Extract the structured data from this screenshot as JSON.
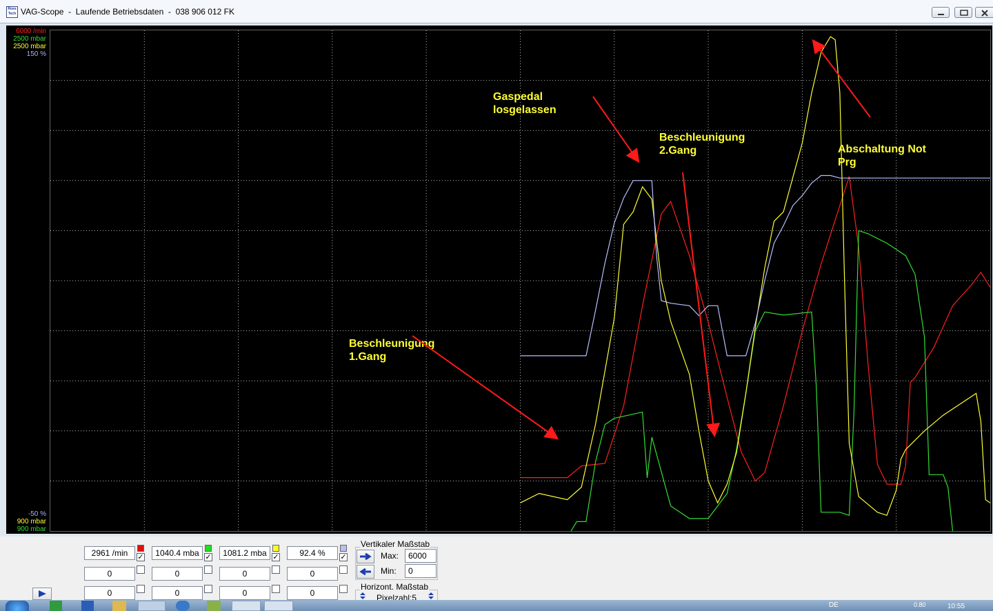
{
  "window": {
    "title": "VAG-Scope  -  Laufende Betriebsdaten  -  038 906 012 FK",
    "app_icon_text": "Ross Tech"
  },
  "scales_top": [
    {
      "text": "6000 /min",
      "color": "#ff2020"
    },
    {
      "text": "2500 mbar",
      "color": "#33dd33"
    },
    {
      "text": "2500 mbar",
      "color": "#ffff33"
    },
    {
      "text": "150 %",
      "color": "#aab4ff"
    }
  ],
  "scales_bottom": [
    {
      "text": "-50 %",
      "color": "#aab4ff"
    },
    {
      "text": "900 mbar",
      "color": "#ffff33"
    },
    {
      "text": "900 mbar",
      "color": "#33dd33"
    }
  ],
  "annotations": {
    "gaspedal": "Gaspedal\nlosgelassen",
    "beschl2": "Beschleunigung\n2.Gang",
    "abschaltung": "Abschaltung Not\nPrg",
    "beschl1": "Beschleunigung\n1.Gang"
  },
  "channels": [
    {
      "value": "2961 /min",
      "color": "#e01010",
      "checked": true
    },
    {
      "value": "1040.4 mba",
      "color": "#22dd22",
      "checked": true
    },
    {
      "value": "1081.2 mba",
      "color": "#ffff22",
      "checked": true
    },
    {
      "value": "92.4 %",
      "color": "#b8c0f0",
      "checked": true
    }
  ],
  "empty_rows": [
    [
      "0",
      "0",
      "0",
      "0"
    ],
    [
      "0",
      "0",
      "0",
      "0"
    ]
  ],
  "vertical_scale": {
    "title": "Vertikaler Maßstab",
    "max_label": "Max:",
    "max_value": "6000",
    "min_label": "Min:",
    "min_value": "0"
  },
  "horizontal_scale": {
    "title": "Horizont. Maßstab",
    "pixel_label": "Pixelzahl:5"
  },
  "taskbar": {
    "lang": "DE",
    "clock": "10:55",
    "zoom": "0.80"
  },
  "chart_data": {
    "type": "line",
    "grid": true,
    "x_divisions": 10,
    "y_divisions": 10,
    "series": [
      {
        "name": "6000 /min",
        "color": "#ff2020",
        "y_range": [
          0,
          6000
        ],
        "points": [
          [
            50,
            640
          ],
          [
            55,
            640
          ],
          [
            56.5,
            780
          ],
          [
            59,
            810
          ],
          [
            61,
            1500
          ],
          [
            63,
            2700
          ],
          [
            65,
            3800
          ],
          [
            66,
            3950
          ],
          [
            68,
            3300
          ],
          [
            70,
            2500
          ],
          [
            72,
            1600
          ],
          [
            73.5,
            950
          ],
          [
            75,
            600
          ],
          [
            76,
            700
          ],
          [
            78,
            1500
          ],
          [
            80,
            2400
          ],
          [
            82,
            3200
          ],
          [
            84,
            3900
          ],
          [
            85,
            4250
          ],
          [
            86,
            3400
          ],
          [
            87,
            2000
          ],
          [
            88,
            800
          ],
          [
            89,
            560
          ],
          [
            90.5,
            560
          ],
          [
            91,
            780
          ],
          [
            91.5,
            1780
          ],
          [
            92,
            1840
          ],
          [
            94,
            2200
          ],
          [
            96,
            2700
          ],
          [
            98,
            2950
          ],
          [
            99,
            3100
          ],
          [
            100,
            2920
          ]
        ]
      },
      {
        "name": "2500 mbar",
        "color": "#33dd33",
        "y_range": [
          900,
          2500
        ],
        "points": [
          [
            50,
            880
          ],
          [
            55,
            880
          ],
          [
            56,
            930
          ],
          [
            57,
            930
          ],
          [
            58,
            1120
          ],
          [
            59,
            1240
          ],
          [
            60,
            1260
          ],
          [
            63,
            1280
          ],
          [
            63.5,
            1070
          ],
          [
            64,
            1200
          ],
          [
            66,
            980
          ],
          [
            68,
            940
          ],
          [
            70,
            940
          ],
          [
            72,
            1020
          ],
          [
            73,
            1160
          ],
          [
            74,
            1340
          ],
          [
            75,
            1540
          ],
          [
            76,
            1600
          ],
          [
            78,
            1590
          ],
          [
            81,
            1600
          ],
          [
            81.5,
            1360
          ],
          [
            82,
            960
          ],
          [
            84,
            960
          ],
          [
            85,
            950
          ],
          [
            85.5,
            1280
          ],
          [
            86,
            1860
          ],
          [
            87,
            1850
          ],
          [
            89,
            1820
          ],
          [
            91,
            1780
          ],
          [
            92,
            1720
          ],
          [
            93,
            1520
          ],
          [
            93.5,
            1080
          ],
          [
            94.5,
            1080
          ],
          [
            95,
            1080
          ],
          [
            95.5,
            1040
          ],
          [
            96,
            900
          ],
          [
            96.5,
            850
          ],
          [
            100,
            850
          ]
        ]
      },
      {
        "name": "2500 mbar",
        "color": "#ffff33",
        "y_range": [
          900,
          2500
        ],
        "points": [
          [
            50,
            990
          ],
          [
            52,
            1020
          ],
          [
            55,
            1000
          ],
          [
            56.5,
            1040
          ],
          [
            58,
            1240
          ],
          [
            60,
            1580
          ],
          [
            61,
            1880
          ],
          [
            62,
            1920
          ],
          [
            63,
            2000
          ],
          [
            64,
            1960
          ],
          [
            65,
            1700
          ],
          [
            66,
            1570
          ],
          [
            68,
            1400
          ],
          [
            69,
            1220
          ],
          [
            70,
            1060
          ],
          [
            71,
            990
          ],
          [
            72,
            1050
          ],
          [
            73,
            1150
          ],
          [
            74,
            1340
          ],
          [
            75,
            1550
          ],
          [
            76,
            1740
          ],
          [
            77,
            1890
          ],
          [
            78,
            1920
          ],
          [
            80,
            2140
          ],
          [
            81,
            2300
          ],
          [
            82,
            2430
          ],
          [
            83,
            2480
          ],
          [
            83.5,
            2470
          ],
          [
            84,
            2300
          ],
          [
            84.5,
            1700
          ],
          [
            85,
            1180
          ],
          [
            86,
            1010
          ],
          [
            88,
            960
          ],
          [
            89,
            950
          ],
          [
            89.5,
            990
          ],
          [
            90,
            1030
          ],
          [
            90.5,
            1130
          ],
          [
            91,
            1160
          ],
          [
            93,
            1220
          ],
          [
            95,
            1270
          ],
          [
            97,
            1310
          ],
          [
            98.5,
            1340
          ],
          [
            99,
            1250
          ],
          [
            99.5,
            1000
          ],
          [
            100,
            990
          ]
        ]
      },
      {
        "name": "150 %",
        "color": "#b8c0ff",
        "y_range": [
          -50,
          150
        ],
        "points": [
          [
            50,
            20
          ],
          [
            53,
            20
          ],
          [
            57,
            20
          ],
          [
            58,
            38
          ],
          [
            59,
            57
          ],
          [
            60,
            73
          ],
          [
            61,
            83
          ],
          [
            62,
            90
          ],
          [
            63,
            90
          ],
          [
            64,
            90
          ],
          [
            64.5,
            60
          ],
          [
            65,
            42
          ],
          [
            66,
            41
          ],
          [
            68,
            40
          ],
          [
            69,
            36
          ],
          [
            69.5,
            38
          ],
          [
            70,
            40
          ],
          [
            71,
            40
          ],
          [
            72,
            20
          ],
          [
            74,
            20
          ],
          [
            75,
            33
          ],
          [
            76,
            50
          ],
          [
            77,
            65
          ],
          [
            78,
            72
          ],
          [
            79,
            80
          ],
          [
            80,
            84
          ],
          [
            81,
            89
          ],
          [
            82,
            92
          ],
          [
            83,
            92
          ],
          [
            84,
            91
          ],
          [
            90,
            91
          ],
          [
            96,
            91
          ],
          [
            100,
            91
          ]
        ]
      }
    ]
  }
}
